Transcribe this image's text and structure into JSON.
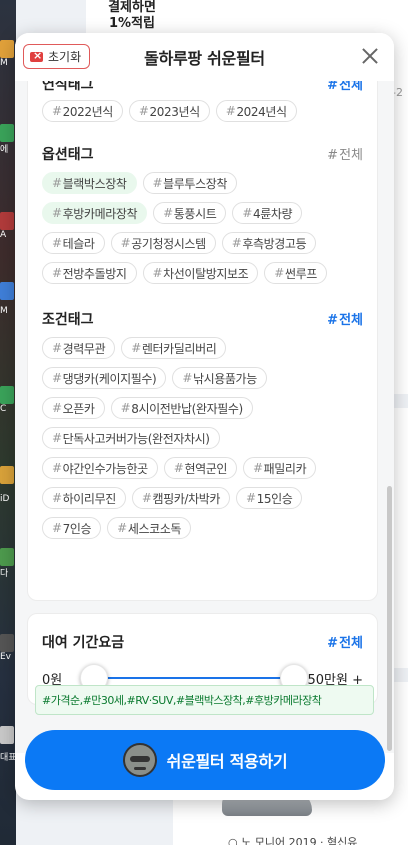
{
  "background": {
    "banner_line1": "결제하면",
    "banner_line2": "1%적립",
    "dash": "-2",
    "bottom_text": "○ 노 모니어 2019 · 혁신유",
    "desktop_labels": [
      "M",
      "에",
      "A",
      "M",
      "C",
      "iD",
      "다",
      "Ev",
      "대표"
    ]
  },
  "header": {
    "reset_label": "초기화",
    "title": "돌하루팡 쉬운필터"
  },
  "sections": [
    {
      "title": "연식태그",
      "all_label": "전체",
      "all_active": true,
      "rows": [
        [
          {
            "label": "2022년식",
            "selected": false
          },
          {
            "label": "2023년식",
            "selected": false
          },
          {
            "label": "2024년식",
            "selected": false
          }
        ]
      ]
    },
    {
      "title": "옵션태그",
      "all_label": "전체",
      "all_active": false,
      "rows": [
        [
          {
            "label": "블랙박스장착",
            "selected": true
          },
          {
            "label": "블루투스장착",
            "selected": false
          }
        ],
        [
          {
            "label": "후방카메라장착",
            "selected": true
          },
          {
            "label": "통풍시트",
            "selected": false
          },
          {
            "label": "4륜차량",
            "selected": false
          }
        ],
        [
          {
            "label": "테슬라",
            "selected": false
          },
          {
            "label": "공기청정시스템",
            "selected": false
          },
          {
            "label": "후측방경고등",
            "selected": false
          }
        ],
        [
          {
            "label": "전방추돌방지",
            "selected": false
          },
          {
            "label": "차선이탈방지보조",
            "selected": false
          },
          {
            "label": "썬루프",
            "selected": false
          }
        ]
      ]
    },
    {
      "title": "조건태그",
      "all_label": "전체",
      "all_active": true,
      "rows": [
        [
          {
            "label": "경력무관",
            "selected": false
          },
          {
            "label": "렌터카딜리버리",
            "selected": false
          }
        ],
        [
          {
            "label": "댕댕카(케이지필수)",
            "selected": false
          },
          {
            "label": "낚시용품가능",
            "selected": false
          }
        ],
        [
          {
            "label": "오픈카",
            "selected": false
          },
          {
            "label": "8시이전반납(완자필수)",
            "selected": false
          }
        ],
        [
          {
            "label": "단독사고커버가능(완전자차시)",
            "selected": false
          }
        ],
        [
          {
            "label": "야간인수가능한곳",
            "selected": false
          },
          {
            "label": "현역군인",
            "selected": false
          },
          {
            "label": "패밀리카",
            "selected": false
          }
        ],
        [
          {
            "label": "하이리무진",
            "selected": false
          },
          {
            "label": "캠핑카/차박카",
            "selected": false
          },
          {
            "label": "15인승",
            "selected": false
          }
        ],
        [
          {
            "label": "7인승",
            "selected": false
          },
          {
            "label": "세스코소독",
            "selected": false
          }
        ]
      ]
    }
  ],
  "price": {
    "title": "대여 기간요금",
    "all_label": "전체",
    "min_label": "0원",
    "max_label": "50만원 +",
    "range_min": 0,
    "range_max": 1
  },
  "summary": {
    "text": "#가격순,#만30세,#RV·SUV,#블랙박스장착,#후방카메라장착"
  },
  "apply": {
    "label": "쉬운필터 적용하기"
  },
  "colors": {
    "accent": "#0b79f5",
    "link": "#1a73e8",
    "selected_tag_bg": "#e9f8ed",
    "summary_text": "#0a7a2f",
    "reset_red": "#e0403f"
  }
}
